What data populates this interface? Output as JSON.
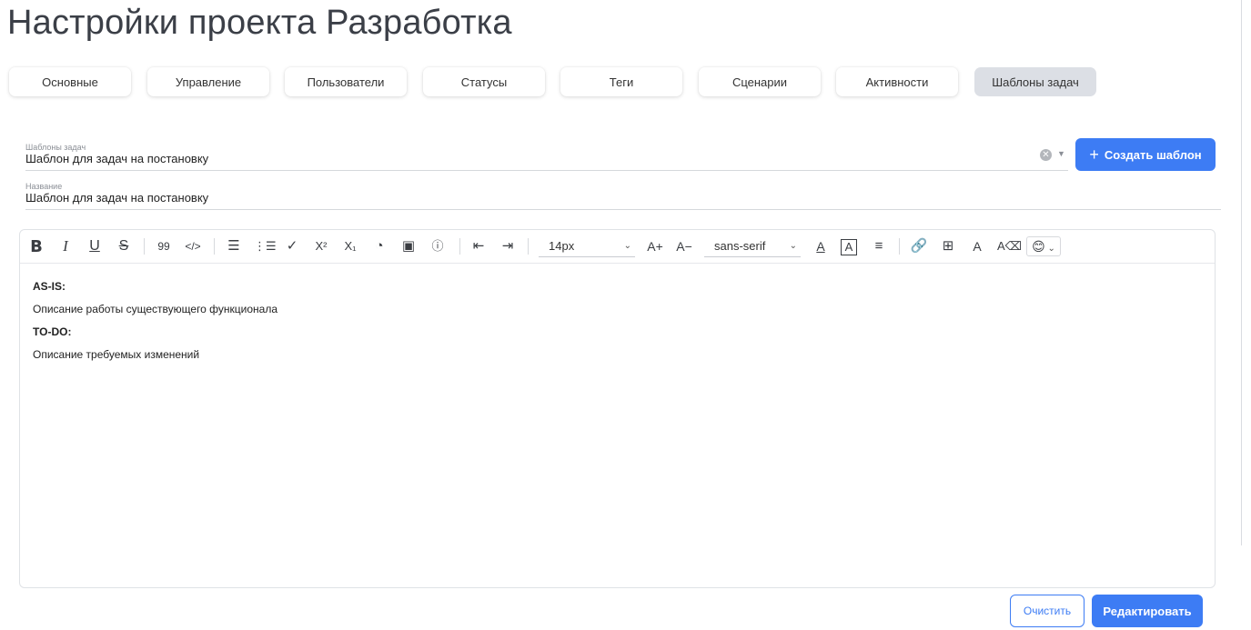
{
  "page": {
    "title": "Настройки проекта Разработка"
  },
  "tabs": [
    {
      "label": "Основные"
    },
    {
      "label": "Управление"
    },
    {
      "label": "Пользователи"
    },
    {
      "label": "Статусы"
    },
    {
      "label": "Теги"
    },
    {
      "label": "Сценарии"
    },
    {
      "label": "Активности"
    },
    {
      "label": "Шаблоны задач",
      "active": true
    }
  ],
  "template_select": {
    "label": "Шаблоны задач",
    "value": "Шаблон для задач на постановку"
  },
  "name_field": {
    "label": "Название",
    "value": "Шаблон для задач на постановку"
  },
  "create_button": {
    "icon": "plus-icon",
    "label": "Создать шаблон"
  },
  "toolbar": {
    "blockquote": "99",
    "code": "</>",
    "font_size": "14px",
    "font_family": "sans-serif",
    "emoji": "😊"
  },
  "editor_content": [
    {
      "text": "AS-IS:",
      "bold": true
    },
    {
      "text": "Описание работы существующего функционала",
      "bold": false
    },
    {
      "text": "TO-DO:",
      "bold": true
    },
    {
      "text": "Описание требуемых изменений",
      "bold": false
    }
  ],
  "actions": {
    "clear_label": "Очистить",
    "edit_label": "Редактировать"
  },
  "colors": {
    "accent": "#3d7cf4",
    "active_tab": "#dcdfe5"
  }
}
